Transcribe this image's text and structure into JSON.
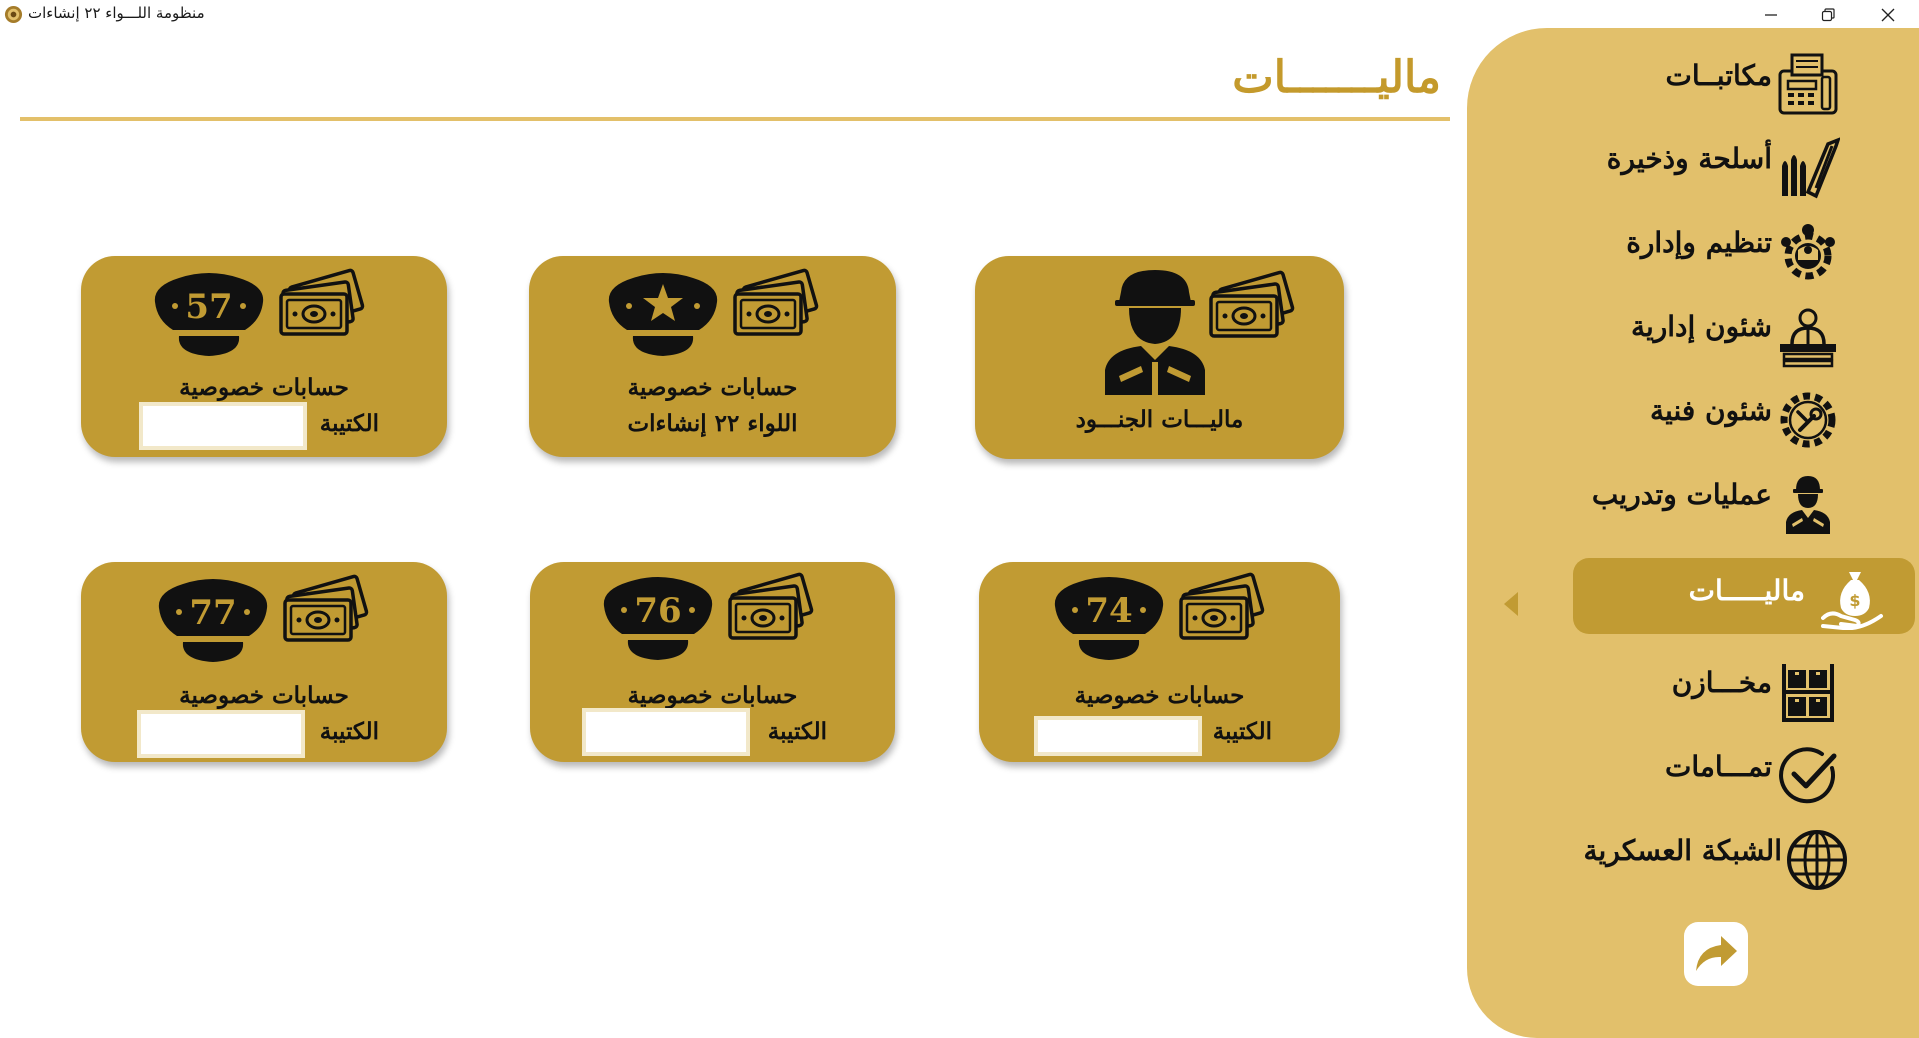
{
  "window": {
    "title": "منظومة اللـــواء ٢٢ إنشاءات",
    "icons": [
      "app-emblem-icon",
      "minimize-icon",
      "restore-icon",
      "close-icon"
    ]
  },
  "page": {
    "title": "ماليـــــــات"
  },
  "cards": [
    {
      "id": "soldiers-finance",
      "line1": "ماليـــات الجنـــود",
      "line2": "",
      "icon": "soldier-with-money-icon"
    },
    {
      "id": "brigade-accounts",
      "line1": "حسابات خصوصية",
      "line2": "اللواء ٢٢ إنشاءات",
      "icon": "officer-cap-star-money-icon"
    },
    {
      "id": "battalion-57",
      "line1": "حسابات خصوصية",
      "line2": "الكتيبة",
      "badge": "57",
      "icon": "officer-cap-57-money-icon"
    },
    {
      "id": "battalion-74",
      "line1": "حسابات خصوصية",
      "line2": "الكتيبة",
      "badge": "74",
      "icon": "officer-cap-74-money-icon"
    },
    {
      "id": "battalion-76",
      "line1": "حسابات خصوصية",
      "line2": "الكتيبة",
      "badge": "76",
      "icon": "officer-cap-76-money-icon"
    },
    {
      "id": "battalion-77",
      "line1": "حسابات خصوصية",
      "line2": "الكتيبة",
      "badge": "77",
      "icon": "officer-cap-77-money-icon"
    }
  ],
  "sidebar": {
    "items": [
      {
        "label": "مكاتبــات",
        "icon": "fax-machine-icon",
        "active": false
      },
      {
        "label": "أسلحة وذخيرة",
        "icon": "weapons-ammo-icon",
        "active": false
      },
      {
        "label": "تنظيم وإدارة",
        "icon": "team-gear-icon",
        "active": false
      },
      {
        "label": "شئون إدارية",
        "icon": "officer-desk-icon",
        "active": false
      },
      {
        "label": "شئون فنية",
        "icon": "gear-wrench-icon",
        "active": false
      },
      {
        "label": "عمليات وتدريب",
        "icon": "soldier-icon",
        "active": false
      },
      {
        "label": "ماليـــــات",
        "icon": "money-bag-hand-icon",
        "active": true
      },
      {
        "label": "مخـــازن",
        "icon": "warehouse-shelves-icon",
        "active": false
      },
      {
        "label": "تمـــامات",
        "icon": "checkmark-circle-icon",
        "active": false
      },
      {
        "label": "الشبكة العسكرية",
        "icon": "globe-icon",
        "active": false
      }
    ],
    "share_icon": "share-arrow-icon"
  },
  "colors": {
    "gold_dark": "#c19b33",
    "gold_light": "#e2c06b",
    "title_gold": "#c49a2c",
    "ink": "#111111"
  }
}
